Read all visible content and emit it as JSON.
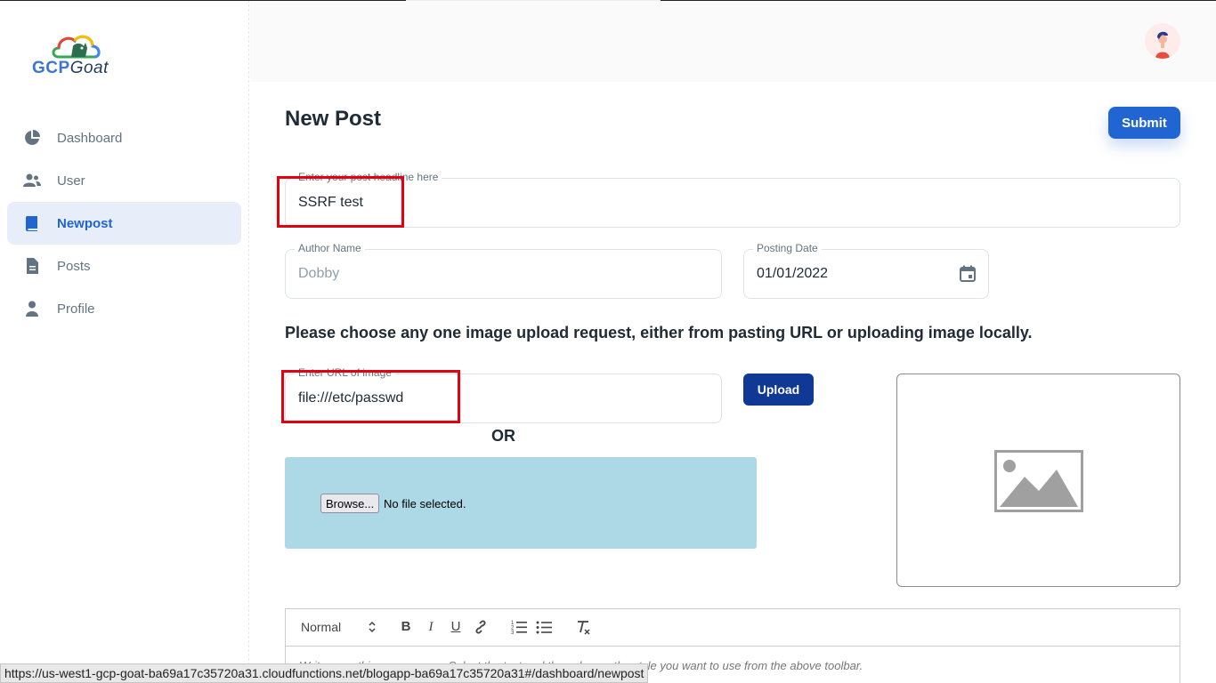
{
  "brand": {
    "logo_gcp": "GCP",
    "logo_goat": "Goat"
  },
  "sidebar": {
    "items": [
      {
        "label": "Dashboard",
        "icon": "pie-chart-icon"
      },
      {
        "label": "User",
        "icon": "people-icon"
      },
      {
        "label": "Newpost",
        "icon": "book-icon",
        "active": true
      },
      {
        "label": "Posts",
        "icon": "file-icon"
      },
      {
        "label": "Profile",
        "icon": "person-icon"
      }
    ]
  },
  "main": {
    "title": "New Post",
    "submit_label": "Submit",
    "headline": {
      "legend": "Enter your post headline here",
      "value": "SSRF test"
    },
    "author": {
      "legend": "Author Name",
      "placeholder": "Dobby"
    },
    "date": {
      "legend": "Posting Date",
      "value": "01/01/2022"
    },
    "instruction": "Please choose any one image upload request, either from pasting URL or uploading image locally.",
    "url": {
      "legend": "Enter URL of image",
      "value": "file:///etc/passwd"
    },
    "upload_label": "Upload",
    "or_text": "OR",
    "file": {
      "browse_label": "Browse...",
      "status": "No file selected."
    },
    "editor": {
      "format_select": "Normal",
      "placeholder": "Write something awesome... Select the text and then choose the style you want to use from the above toolbar."
    }
  },
  "status_bar": {
    "url": "https://us-west1-gcp-goat-ba69a17c35720a31.cloudfunctions.net/blogapp-ba69a17c35720a31#/dashboard/newpost"
  },
  "colors": {
    "primary": "#2065d1",
    "upload": "#103996",
    "file_zone": "#add8e6",
    "highlight": "#e3000f"
  }
}
